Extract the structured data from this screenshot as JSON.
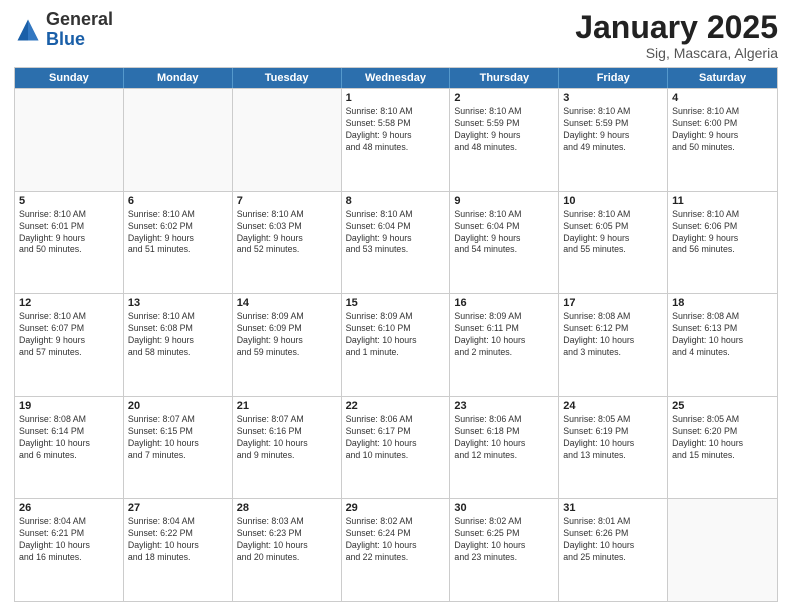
{
  "header": {
    "logo_general": "General",
    "logo_blue": "Blue",
    "month_title": "January 2025",
    "subtitle": "Sig, Mascara, Algeria"
  },
  "days_of_week": [
    "Sunday",
    "Monday",
    "Tuesday",
    "Wednesday",
    "Thursday",
    "Friday",
    "Saturday"
  ],
  "rows": [
    [
      {
        "day": "",
        "text": ""
      },
      {
        "day": "",
        "text": ""
      },
      {
        "day": "",
        "text": ""
      },
      {
        "day": "1",
        "text": "Sunrise: 8:10 AM\nSunset: 5:58 PM\nDaylight: 9 hours\nand 48 minutes."
      },
      {
        "day": "2",
        "text": "Sunrise: 8:10 AM\nSunset: 5:59 PM\nDaylight: 9 hours\nand 48 minutes."
      },
      {
        "day": "3",
        "text": "Sunrise: 8:10 AM\nSunset: 5:59 PM\nDaylight: 9 hours\nand 49 minutes."
      },
      {
        "day": "4",
        "text": "Sunrise: 8:10 AM\nSunset: 6:00 PM\nDaylight: 9 hours\nand 50 minutes."
      }
    ],
    [
      {
        "day": "5",
        "text": "Sunrise: 8:10 AM\nSunset: 6:01 PM\nDaylight: 9 hours\nand 50 minutes."
      },
      {
        "day": "6",
        "text": "Sunrise: 8:10 AM\nSunset: 6:02 PM\nDaylight: 9 hours\nand 51 minutes."
      },
      {
        "day": "7",
        "text": "Sunrise: 8:10 AM\nSunset: 6:03 PM\nDaylight: 9 hours\nand 52 minutes."
      },
      {
        "day": "8",
        "text": "Sunrise: 8:10 AM\nSunset: 6:04 PM\nDaylight: 9 hours\nand 53 minutes."
      },
      {
        "day": "9",
        "text": "Sunrise: 8:10 AM\nSunset: 6:04 PM\nDaylight: 9 hours\nand 54 minutes."
      },
      {
        "day": "10",
        "text": "Sunrise: 8:10 AM\nSunset: 6:05 PM\nDaylight: 9 hours\nand 55 minutes."
      },
      {
        "day": "11",
        "text": "Sunrise: 8:10 AM\nSunset: 6:06 PM\nDaylight: 9 hours\nand 56 minutes."
      }
    ],
    [
      {
        "day": "12",
        "text": "Sunrise: 8:10 AM\nSunset: 6:07 PM\nDaylight: 9 hours\nand 57 minutes."
      },
      {
        "day": "13",
        "text": "Sunrise: 8:10 AM\nSunset: 6:08 PM\nDaylight: 9 hours\nand 58 minutes."
      },
      {
        "day": "14",
        "text": "Sunrise: 8:09 AM\nSunset: 6:09 PM\nDaylight: 9 hours\nand 59 minutes."
      },
      {
        "day": "15",
        "text": "Sunrise: 8:09 AM\nSunset: 6:10 PM\nDaylight: 10 hours\nand 1 minute."
      },
      {
        "day": "16",
        "text": "Sunrise: 8:09 AM\nSunset: 6:11 PM\nDaylight: 10 hours\nand 2 minutes."
      },
      {
        "day": "17",
        "text": "Sunrise: 8:08 AM\nSunset: 6:12 PM\nDaylight: 10 hours\nand 3 minutes."
      },
      {
        "day": "18",
        "text": "Sunrise: 8:08 AM\nSunset: 6:13 PM\nDaylight: 10 hours\nand 4 minutes."
      }
    ],
    [
      {
        "day": "19",
        "text": "Sunrise: 8:08 AM\nSunset: 6:14 PM\nDaylight: 10 hours\nand 6 minutes."
      },
      {
        "day": "20",
        "text": "Sunrise: 8:07 AM\nSunset: 6:15 PM\nDaylight: 10 hours\nand 7 minutes."
      },
      {
        "day": "21",
        "text": "Sunrise: 8:07 AM\nSunset: 6:16 PM\nDaylight: 10 hours\nand 9 minutes."
      },
      {
        "day": "22",
        "text": "Sunrise: 8:06 AM\nSunset: 6:17 PM\nDaylight: 10 hours\nand 10 minutes."
      },
      {
        "day": "23",
        "text": "Sunrise: 8:06 AM\nSunset: 6:18 PM\nDaylight: 10 hours\nand 12 minutes."
      },
      {
        "day": "24",
        "text": "Sunrise: 8:05 AM\nSunset: 6:19 PM\nDaylight: 10 hours\nand 13 minutes."
      },
      {
        "day": "25",
        "text": "Sunrise: 8:05 AM\nSunset: 6:20 PM\nDaylight: 10 hours\nand 15 minutes."
      }
    ],
    [
      {
        "day": "26",
        "text": "Sunrise: 8:04 AM\nSunset: 6:21 PM\nDaylight: 10 hours\nand 16 minutes."
      },
      {
        "day": "27",
        "text": "Sunrise: 8:04 AM\nSunset: 6:22 PM\nDaylight: 10 hours\nand 18 minutes."
      },
      {
        "day": "28",
        "text": "Sunrise: 8:03 AM\nSunset: 6:23 PM\nDaylight: 10 hours\nand 20 minutes."
      },
      {
        "day": "29",
        "text": "Sunrise: 8:02 AM\nSunset: 6:24 PM\nDaylight: 10 hours\nand 22 minutes."
      },
      {
        "day": "30",
        "text": "Sunrise: 8:02 AM\nSunset: 6:25 PM\nDaylight: 10 hours\nand 23 minutes."
      },
      {
        "day": "31",
        "text": "Sunrise: 8:01 AM\nSunset: 6:26 PM\nDaylight: 10 hours\nand 25 minutes."
      },
      {
        "day": "",
        "text": ""
      }
    ]
  ]
}
